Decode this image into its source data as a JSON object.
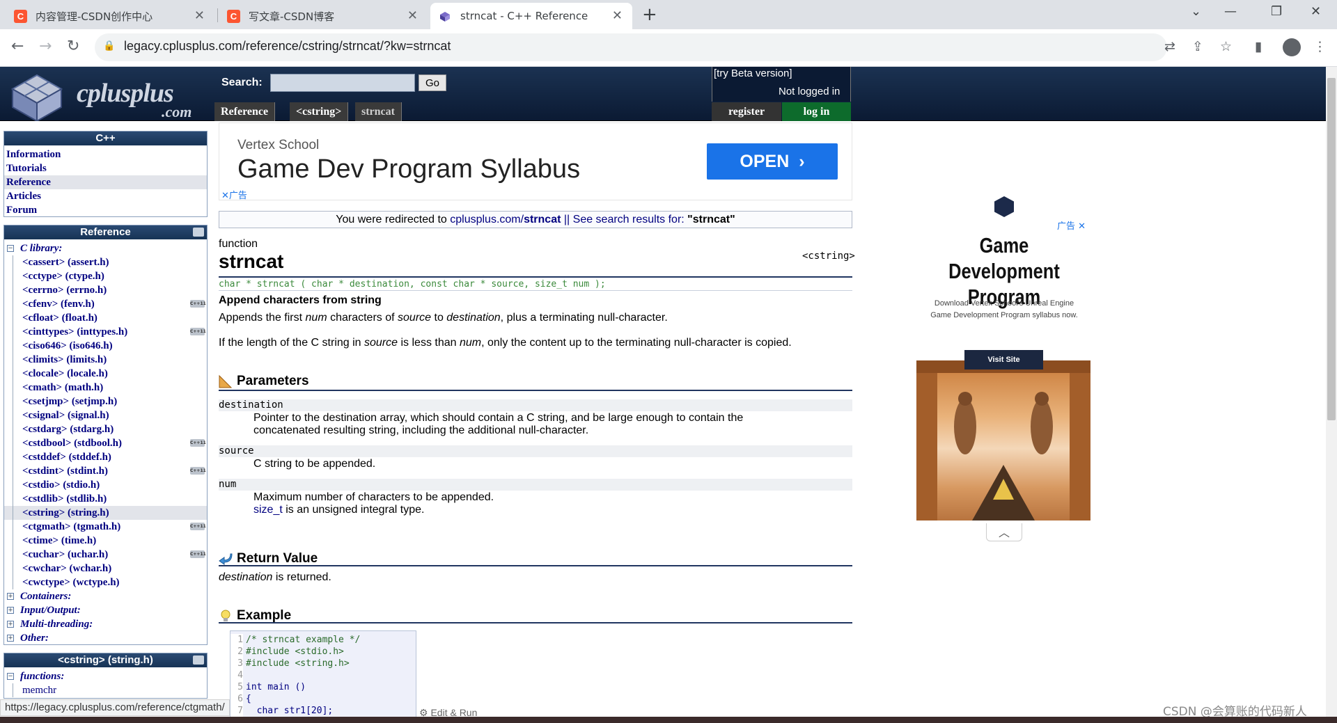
{
  "browser": {
    "tabs": [
      {
        "title": "内容管理-CSDN创作中心",
        "favicon": "C",
        "active": false
      },
      {
        "title": "写文章-CSDN博客",
        "favicon": "C",
        "active": false
      },
      {
        "title": "strncat - C++ Reference",
        "favicon": "cplusplus-logo",
        "active": true
      }
    ],
    "url": "legacy.cplusplus.com/reference/cstring/strncat/?kw=strncat",
    "colors": {
      "csdn": "#fc5531",
      "tabbar": "#dee1e6"
    }
  },
  "header": {
    "logo_text": "cplusplus",
    "logo_com": ".com",
    "search_label": "Search:",
    "search_value": "",
    "go_label": "Go",
    "beta_link": "[try Beta version]",
    "login_status": "Not logged in",
    "register_label": "register",
    "login_label": "log in",
    "breadcrumb": [
      "Reference",
      "<cstring>",
      "strncat"
    ]
  },
  "sidebar": {
    "cpp_box": {
      "title": "C++",
      "items": [
        "Information",
        "Tutorials",
        "Reference",
        "Articles",
        "Forum"
      ],
      "selected": "Reference"
    },
    "reference_box": {
      "title": "Reference",
      "c_library_label": "C library:",
      "headers": [
        {
          "label": "<cassert> (assert.h)",
          "cpp11": false
        },
        {
          "label": "<cctype> (ctype.h)",
          "cpp11": false
        },
        {
          "label": "<cerrno> (errno.h)",
          "cpp11": false
        },
        {
          "label": "<cfenv> (fenv.h)",
          "cpp11": true
        },
        {
          "label": "<cfloat> (float.h)",
          "cpp11": false
        },
        {
          "label": "<cinttypes> (inttypes.h)",
          "cpp11": true
        },
        {
          "label": "<ciso646> (iso646.h)",
          "cpp11": false
        },
        {
          "label": "<climits> (limits.h)",
          "cpp11": false
        },
        {
          "label": "<clocale> (locale.h)",
          "cpp11": false
        },
        {
          "label": "<cmath> (math.h)",
          "cpp11": false
        },
        {
          "label": "<csetjmp> (setjmp.h)",
          "cpp11": false
        },
        {
          "label": "<csignal> (signal.h)",
          "cpp11": false
        },
        {
          "label": "<cstdarg> (stdarg.h)",
          "cpp11": false
        },
        {
          "label": "<cstdbool> (stdbool.h)",
          "cpp11": true
        },
        {
          "label": "<cstddef> (stddef.h)",
          "cpp11": false
        },
        {
          "label": "<cstdint> (stdint.h)",
          "cpp11": true
        },
        {
          "label": "<cstdio> (stdio.h)",
          "cpp11": false
        },
        {
          "label": "<cstdlib> (stdlib.h)",
          "cpp11": false
        },
        {
          "label": "<cstring> (string.h)",
          "cpp11": false
        },
        {
          "label": "<ctgmath> (tgmath.h)",
          "cpp11": true
        },
        {
          "label": "<ctime> (time.h)",
          "cpp11": false
        },
        {
          "label": "<cuchar> (uchar.h)",
          "cpp11": true
        },
        {
          "label": "<cwchar> (wchar.h)",
          "cpp11": false
        },
        {
          "label": "<cwctype> (wctype.h)",
          "cpp11": false
        }
      ],
      "selected_header": "<cstring> (string.h)",
      "cpp11_badge": "C++11",
      "collapsed": [
        "Containers:",
        "Input/Output:",
        "Multi-threading:",
        "Other:"
      ]
    },
    "cstring_box": {
      "title": "<cstring> (string.h)",
      "functions_label": "functions:",
      "first_item": "memchr"
    }
  },
  "ad_top": {
    "brand": "Vertex School",
    "title": "Game Dev Program Syllabus",
    "open_label": "OPEN",
    "ad_label": "广告"
  },
  "redirect": {
    "prefix": "You were redirected to ",
    "link_plain": "cplusplus.com/",
    "link_bold": "strncat",
    "middle": " || See search results for: ",
    "query": "\"strncat\""
  },
  "article": {
    "kind": "function",
    "name": "strncat",
    "header": "<cstring>",
    "prototype": "char * strncat ( char * destination, const char * source, size_t num );",
    "brief": "Append characters from string",
    "desc1": {
      "a": "Appends the first ",
      "num": "num",
      "b": " characters of ",
      "source": "source",
      "c": " to ",
      "dest": "destination",
      "d": ", plus a terminating null-character."
    },
    "desc2": {
      "a": "If the length of the C string in ",
      "source": "source",
      "b": " is less than ",
      "num": "num",
      "c": ", only the content up to the terminating null-character is copied."
    },
    "params_title": "Parameters",
    "params": [
      {
        "name": "destination",
        "desc": [
          "Pointer to the destination array, which should contain a C string, and be large enough to contain the",
          "concatenated resulting string, including the additional null-character."
        ]
      },
      {
        "name": "source",
        "desc": [
          "C string to be appended."
        ]
      },
      {
        "name": "num",
        "desc": [
          "Maximum number of characters to be appended."
        ],
        "extra_link": "size_t",
        "extra_text": " is an unsigned integral type."
      }
    ],
    "return_title": "Return Value",
    "return_var": "destination",
    "return_text": " is returned.",
    "example_title": "Example",
    "code": [
      {
        "n": "1",
        "t": "/* strncat example */"
      },
      {
        "n": "2",
        "t": "#include <stdio.h>"
      },
      {
        "n": "3",
        "t": "#include <string.h>"
      },
      {
        "n": "4",
        "t": ""
      },
      {
        "n": "5",
        "t": "int main ()"
      },
      {
        "n": "6",
        "t": "{"
      },
      {
        "n": "7",
        "t": "  char str1[20];"
      }
    ],
    "edit_run": "Edit & Run"
  },
  "ad_right": {
    "ad_label": "广告",
    "title_line1": "Game Development",
    "title_line2": "Program",
    "sub_line1": "Download Vertex School's Unreal Engine",
    "sub_line2": "Game Development Program syllabus now.",
    "visit_label": "Visit Site"
  },
  "status_url": "https://legacy.cplusplus.com/reference/ctgmath/",
  "watermark": "CSDN @会算账的代码新人"
}
